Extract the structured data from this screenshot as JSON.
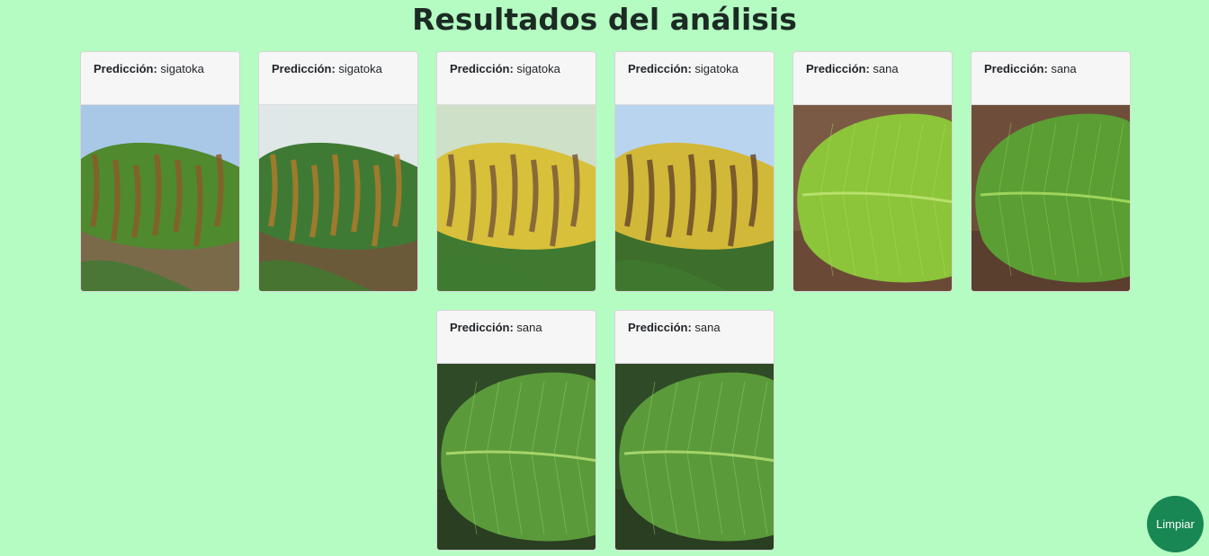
{
  "page": {
    "title": "Resultados del análisis"
  },
  "result_label": "Predicción:",
  "results": [
    {
      "prediction": "sigatoka",
      "image": "leaf-sigatoka-1",
      "palette": {
        "sky": "#a9c8e8",
        "leaf": "#4f8a2e",
        "spot": "#8a5a2a",
        "ground": "#7a6a4a"
      }
    },
    {
      "prediction": "sigatoka",
      "image": "leaf-sigatoka-2",
      "palette": {
        "sky": "#dfe8e6",
        "leaf": "#3f7a35",
        "spot": "#b07a2a",
        "ground": "#6b5a3a"
      }
    },
    {
      "prediction": "sigatoka",
      "image": "leaf-sigatoka-3",
      "palette": {
        "sky": "#cfe0c8",
        "leaf": "#d8c03a",
        "spot": "#7a5a3a",
        "ground": "#3f7a30"
      }
    },
    {
      "prediction": "sigatoka",
      "image": "leaf-sigatoka-4",
      "palette": {
        "sky": "#b8d4ee",
        "leaf": "#d2b838",
        "spot": "#6a4a2a",
        "ground": "#3e6e2c"
      }
    },
    {
      "prediction": "sana",
      "image": "leaf-sana-1",
      "palette": {
        "sky": "#7a5a44",
        "leaf": "#8cc43a",
        "spot": "#b8e06a",
        "ground": "#6a4a36"
      }
    },
    {
      "prediction": "sana",
      "image": "leaf-sana-2",
      "palette": {
        "sky": "#6e4e3a",
        "leaf": "#5a9e34",
        "spot": "#9ed45a",
        "ground": "#5a3e2e"
      }
    },
    {
      "prediction": "sana",
      "image": "leaf-sana-3",
      "palette": {
        "sky": "#2f4a26",
        "leaf": "#5a9a3a",
        "spot": "#a6d46a",
        "ground": "#2a3e22"
      }
    },
    {
      "prediction": "sana",
      "image": "leaf-sana-4",
      "palette": {
        "sky": "#2f4a26",
        "leaf": "#5a9a3a",
        "spot": "#a6d46a",
        "ground": "#2a3e22"
      }
    }
  ],
  "actions": {
    "clear_label": "Limpiar"
  },
  "colors": {
    "background": "#b4fcc2",
    "clear_button": "#198754",
    "card_header": "#f6f6f6"
  }
}
